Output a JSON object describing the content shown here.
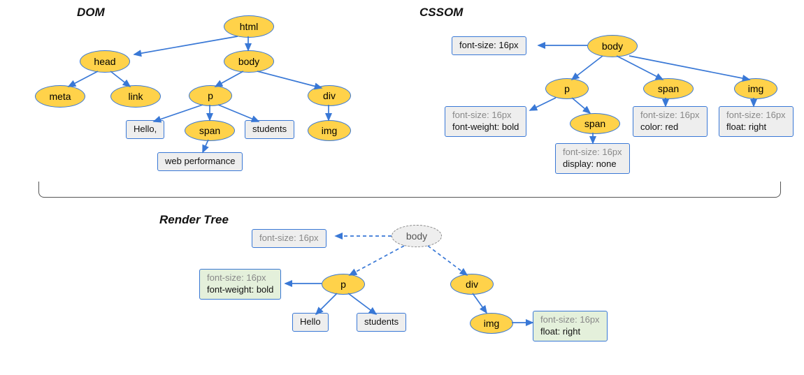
{
  "titles": {
    "dom": "DOM",
    "cssom": "CSSOM",
    "render": "Render Tree"
  },
  "dom": {
    "html": "html",
    "head": "head",
    "body": "body",
    "meta": "meta",
    "link": "link",
    "p": "p",
    "div": "div",
    "span": "span",
    "img": "img",
    "text_hello": "Hello,",
    "text_students": "students",
    "text_webperf": "web performance"
  },
  "cssom": {
    "body": "body",
    "p": "p",
    "span1": "span",
    "span2": "span",
    "img": "img",
    "body_css": {
      "fs": "font-size: 16px"
    },
    "p_css": {
      "fs": "font-size: 16px",
      "own": "font-weight: bold"
    },
    "span1_css": {
      "fs": "font-size: 16px",
      "own": "color: red"
    },
    "img_css": {
      "fs": "font-size: 16px",
      "own": "float: right"
    },
    "span2_css": {
      "fs": "font-size: 16px",
      "own": "display: none"
    }
  },
  "render": {
    "body": "body",
    "p": "p",
    "div": "div",
    "img": "img",
    "body_css": {
      "fs": "font-size: 16px"
    },
    "p_css": {
      "fs": "font-size: 16px",
      "own": "font-weight: bold"
    },
    "img_css": {
      "fs": "font-size: 16px",
      "own": "float: right"
    },
    "text_hello": "Hello",
    "text_students": "students"
  }
}
